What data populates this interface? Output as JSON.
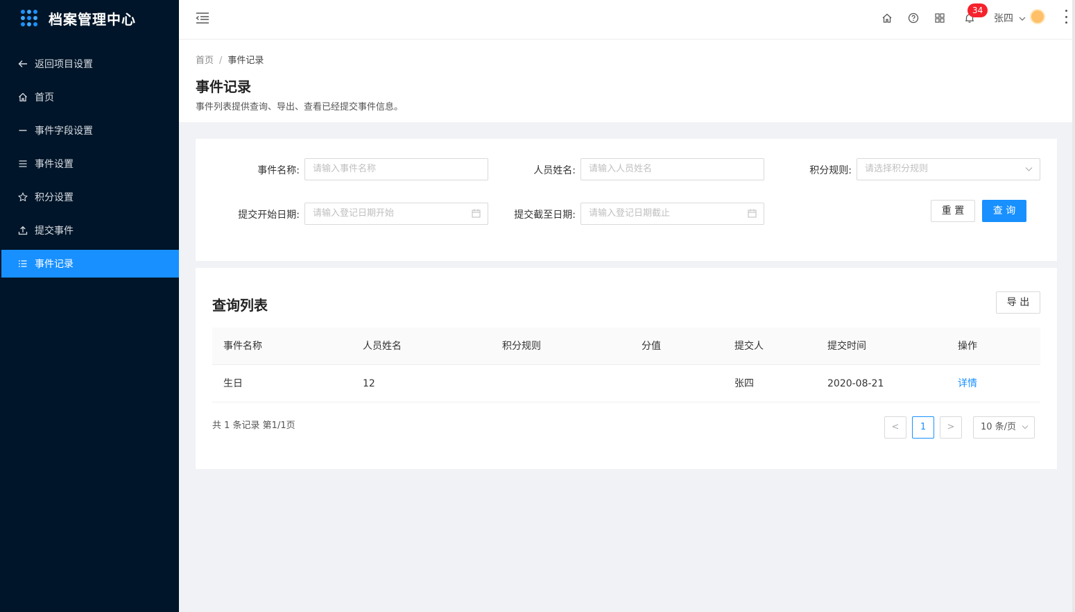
{
  "app": {
    "title": "档案管理中心"
  },
  "sidebar": {
    "items": [
      {
        "label": "返回项目设置",
        "icon": "arrow-left-icon"
      },
      {
        "label": "首页",
        "icon": "home-icon"
      },
      {
        "label": "事件字段设置",
        "icon": "minus-icon"
      },
      {
        "label": "事件设置",
        "icon": "menu-icon"
      },
      {
        "label": "积分设置",
        "icon": "star-icon"
      },
      {
        "label": "提交事件",
        "icon": "upload-icon"
      },
      {
        "label": "事件记录",
        "icon": "list-icon",
        "active": true
      }
    ]
  },
  "header": {
    "notification_count": "34",
    "user_name": "张四"
  },
  "breadcrumb": {
    "home": "首页",
    "separator": "/",
    "current": "事件记录"
  },
  "page": {
    "title": "事件记录",
    "description": "事件列表提供查询、导出、查看已经提交事件信息。"
  },
  "filters": {
    "event_name": {
      "label": "事件名称:",
      "placeholder": "请输入事件名称"
    },
    "person_name": {
      "label": "人员姓名:",
      "placeholder": "请输入人员姓名"
    },
    "points_rule": {
      "label": "积分规则:",
      "placeholder": "请选择积分规则"
    },
    "start_date": {
      "label": "提交开始日期:",
      "placeholder": "请输入登记日期开始"
    },
    "end_date": {
      "label": "提交截至日期:",
      "placeholder": "请输入登记日期截止"
    },
    "reset_label": "重 置",
    "search_label": "查 询"
  },
  "list": {
    "title": "查询列表",
    "export_label": "导 出",
    "columns": [
      "事件名称",
      "人员姓名",
      "积分规则",
      "分值",
      "提交人",
      "提交时间",
      "操作"
    ],
    "rows": [
      {
        "event_name": "生日",
        "person_name": "12",
        "points_rule": "",
        "score": "",
        "submitter": "张四",
        "submit_time": "2020-08-21",
        "action": "详情"
      }
    ]
  },
  "pagination": {
    "summary": "共 1 条记录 第1/1页",
    "prev": "<",
    "current_page": "1",
    "next": ">",
    "page_size": "10 条/页"
  },
  "colors": {
    "primary": "#1890ff",
    "sidebar_bg": "#001529",
    "badge": "#f5222d"
  }
}
